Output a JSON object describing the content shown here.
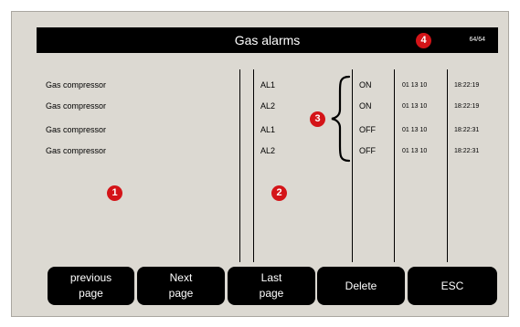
{
  "header": {
    "title": "Gas alarms",
    "page_count": "64/64"
  },
  "alarms": [
    {
      "name": "Gas compressor",
      "code": "AL1",
      "state": "ON",
      "date": "01 13 10",
      "time": "18:22:19"
    },
    {
      "name": "Gas compressor",
      "code": "AL2",
      "state": "ON",
      "date": "01 13 10",
      "time": "18:22:19"
    },
    {
      "name": "Gas compressor",
      "code": "AL1",
      "state": "OFF",
      "date": "01 13 10",
      "time": "18:22:31"
    },
    {
      "name": "Gas compressor",
      "code": "AL2",
      "state": "OFF",
      "date": "01 13 10",
      "time": "18:22:31"
    }
  ],
  "callouts": [
    "1",
    "2",
    "3",
    "4"
  ],
  "buttons": {
    "previous_page": "previous\npage",
    "next_page": "Next\npage",
    "last_page": "Last\npage",
    "delete": "Delete",
    "esc": "ESC"
  },
  "colors": {
    "panel_background": "#dcd9d2",
    "title_bar": "#000000",
    "callout_badge": "#d41418"
  }
}
